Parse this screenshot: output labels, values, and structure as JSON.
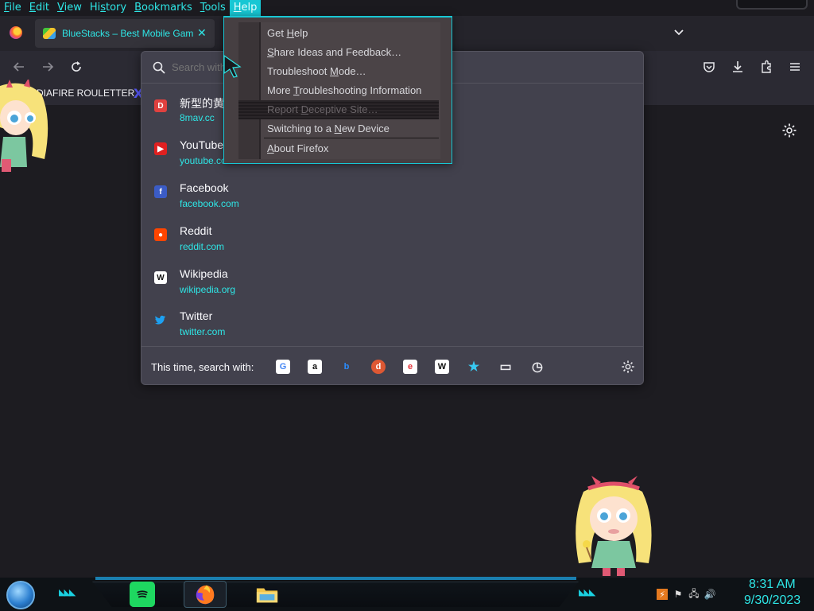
{
  "menubar": {
    "items": [
      {
        "pre": "",
        "u": "F",
        "post": "ile"
      },
      {
        "pre": "",
        "u": "E",
        "post": "dit"
      },
      {
        "pre": "",
        "u": "V",
        "post": "iew"
      },
      {
        "pre": "Hi",
        "u": "s",
        "post": "tory"
      },
      {
        "pre": "",
        "u": "B",
        "post": "ookmarks"
      },
      {
        "pre": "",
        "u": "T",
        "post": "ools"
      },
      {
        "pre": "",
        "u": "H",
        "post": "elp"
      }
    ]
  },
  "tabs": [
    {
      "title": "BlueStacks – Best Mobile Gaming",
      "close": "✕"
    }
  ],
  "bookmarks": {
    "item1": "EDIAFIRE ROULETTER",
    "item2": "X"
  },
  "urlbar": {
    "placeholder": "Search with"
  },
  "results": [
    {
      "title": "新型的黄",
      "url": "8mav.cc",
      "favicon_char": "D",
      "favicon_bg": "#e0413f"
    },
    {
      "title": "YouTube",
      "url": "youtube.com",
      "favicon_char": "▶",
      "favicon_bg": "#e02020"
    },
    {
      "title": "Facebook",
      "url": "facebook.com",
      "favicon_char": "f",
      "favicon_bg": "#3b5cc6"
    },
    {
      "title": "Reddit",
      "url": "reddit.com",
      "favicon_char": "●",
      "favicon_bg": "#ff4500"
    },
    {
      "title": "Wikipedia",
      "url": "wikipedia.org",
      "favicon_char": "W",
      "favicon_bg": "#ffffff"
    },
    {
      "title": "Twitter",
      "url": "twitter.com",
      "favicon_char": "🐦",
      "favicon_bg": "transparent"
    }
  ],
  "oneoff": {
    "label": "This time, search with:",
    "engines": [
      {
        "name": "google-icon",
        "glyph": "G",
        "bg": "#ffffff",
        "fg": "#4285f4"
      },
      {
        "name": "amazon-icon",
        "glyph": "a",
        "bg": "#ffffff",
        "fg": "#111111"
      },
      {
        "name": "bing-icon",
        "glyph": "b",
        "bg": "transparent",
        "fg": "#2a8cff"
      },
      {
        "name": "duckduckgo-icon",
        "glyph": "d",
        "bg": "#de5833",
        "fg": "#ffffff"
      },
      {
        "name": "ebay-icon",
        "glyph": "e",
        "bg": "#ffffff",
        "fg": "#e53238"
      },
      {
        "name": "wikipedia-icon",
        "glyph": "W",
        "bg": "#ffffff",
        "fg": "#111111"
      },
      {
        "name": "bookmarks-star-icon",
        "glyph": "★",
        "bg": "transparent",
        "fg": "#38c8f0"
      },
      {
        "name": "tabs-icon",
        "glyph": "▭",
        "bg": "transparent",
        "fg": "#e8e8ec"
      },
      {
        "name": "history-icon",
        "glyph": "◷",
        "bg": "transparent",
        "fg": "#e8e8ec"
      }
    ]
  },
  "help_menu": {
    "items": [
      {
        "pre": "Get ",
        "u": "H",
        "post": "elp"
      },
      {
        "pre": "",
        "u": "S",
        "post": "hare Ideas and Feedback…"
      },
      {
        "pre": "Troubleshoot ",
        "u": "M",
        "post": "ode…"
      },
      {
        "pre": "More ",
        "u": "T",
        "post": "roubleshooting Information"
      },
      {
        "pre": "Report ",
        "u": "D",
        "post": "eceptive Site…"
      },
      {
        "pre": "Switching to a ",
        "u": "N",
        "post": "ew Device"
      },
      {
        "pre": "",
        "u": "A",
        "post": "bout Firefox"
      }
    ]
  },
  "clock": {
    "time": "8:31 AM",
    "date": "9/30/2023"
  },
  "colors": {
    "accent": "#2ee6e6",
    "menu_highlight": "#17c7d4",
    "panel_bg": "#42414d"
  }
}
